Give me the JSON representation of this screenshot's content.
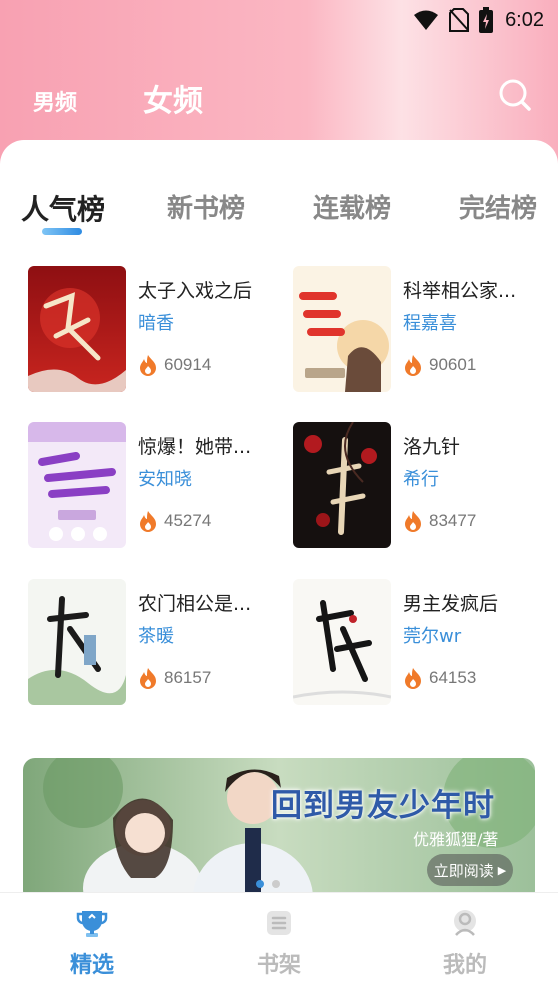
{
  "status_bar": {
    "time": "6:02",
    "icons": [
      "wifi-icon",
      "no-sim-icon",
      "battery-charging-icon"
    ]
  },
  "header": {
    "tabs": [
      {
        "label": "男频",
        "active": false
      },
      {
        "label": "女频",
        "active": true
      }
    ],
    "search_icon": "search-icon"
  },
  "ranking_tabs": [
    {
      "label": "人气榜",
      "active": true
    },
    {
      "label": "新书榜",
      "active": false
    },
    {
      "label": "连载榜",
      "active": false
    },
    {
      "label": "完结榜",
      "active": false
    }
  ],
  "books": [
    {
      "title": "太子入戏之后",
      "author": "暗香",
      "heat": "60914"
    },
    {
      "title": "科举相公家...",
      "author": "程嘉喜",
      "heat": "90601"
    },
    {
      "title": "惊爆！她带...",
      "author": "安知晓",
      "heat": "45274"
    },
    {
      "title": "洛九针",
      "author": "希行",
      "heat": "83477"
    },
    {
      "title": "农门相公是...",
      "author": "茶暖",
      "heat": "86157"
    },
    {
      "title": "男主发疯后",
      "author": "莞尔wr",
      "heat": "64153"
    }
  ],
  "banner": {
    "title": "回到男友少年时",
    "author": "优雅狐狸/著",
    "button": "立即阅读"
  },
  "bottom_nav": [
    {
      "label": "精选",
      "icon": "trophy-icon",
      "active": true
    },
    {
      "label": "书架",
      "icon": "bookshelf-icon",
      "active": false
    },
    {
      "label": "我的",
      "icon": "user-icon",
      "active": false
    }
  ],
  "colors": {
    "header_pink": "#f8a1b2",
    "accent_blue": "#3a8fd9",
    "heat_orange": "#f07a2a"
  }
}
